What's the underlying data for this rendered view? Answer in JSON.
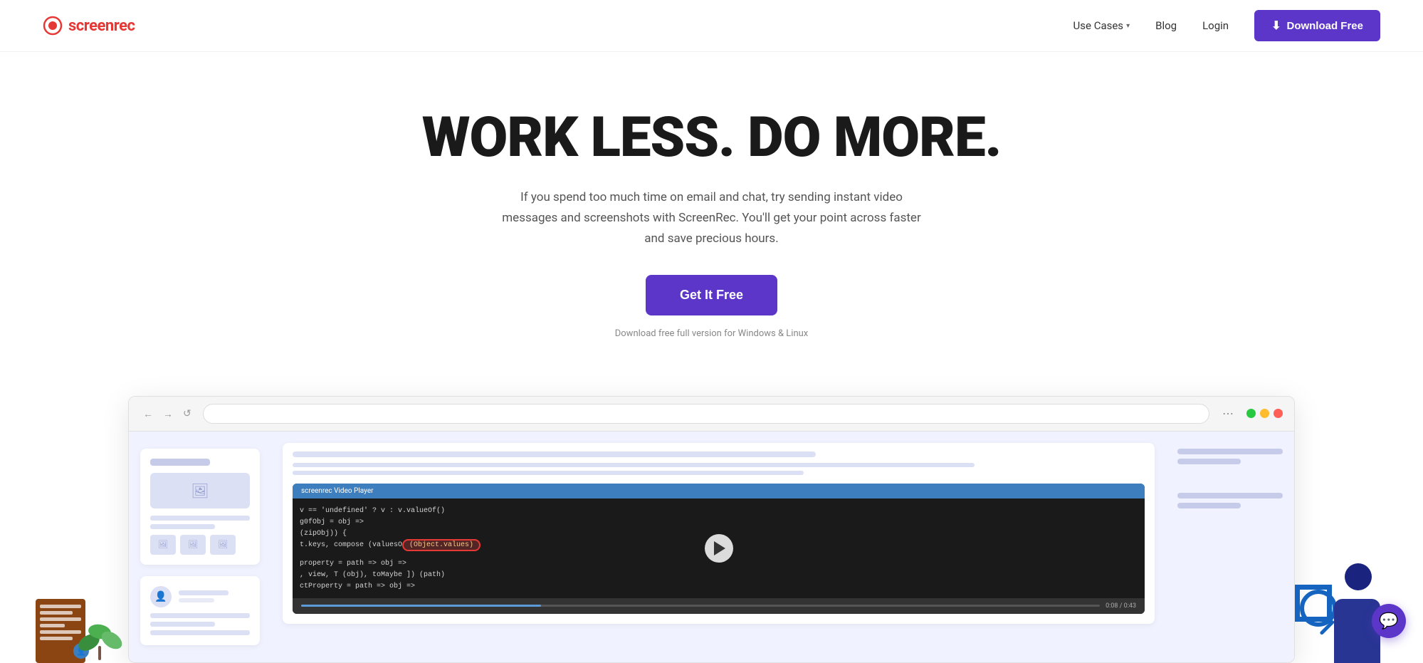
{
  "brand": {
    "name_prefix": "screen",
    "name_suffix": "rec",
    "logo_dot_color": "#e53935"
  },
  "navbar": {
    "use_cases_label": "Use Cases",
    "blog_label": "Blog",
    "login_label": "Login",
    "download_btn_label": "Download Free",
    "download_icon": "⬇"
  },
  "hero": {
    "title": "WORK LESS. DO MORE.",
    "subtitle": "If you spend too much time on email and chat, try sending instant video messages and screenshots with ScreenRec. You'll get your point across faster and save precious hours.",
    "cta_label": "Get It Free",
    "cta_note": "Download free full version for Windows & Linux"
  },
  "browser": {
    "address_value": "",
    "address_placeholder": "",
    "more_icon": "⋯",
    "back_icon": "←",
    "forward_icon": "→",
    "refresh_icon": "↺",
    "video_player_title": "screenrec Video Player",
    "code_line_1": "v == 'undefined' ? v : v.valueOf()",
    "code_line_2": "g0fObj = obj =>",
    "code_line_3": "(zipObj)) {",
    "code_line_4": "t.keys, compose (valuesO",
    "code_highlight": "(Object.values)",
    "code_line_5": "",
    "code_line_6": "property = path => obj =>",
    "code_line_7": ", view, T (obj), toMaybe ]) (path)",
    "code_line_8": "ctProperty = path => obj =>",
    "time_display": "0:08 / 0:43",
    "traffic_lights": [
      "green",
      "yellow",
      "red"
    ]
  },
  "chat_bubble": {
    "icon": "💬"
  }
}
